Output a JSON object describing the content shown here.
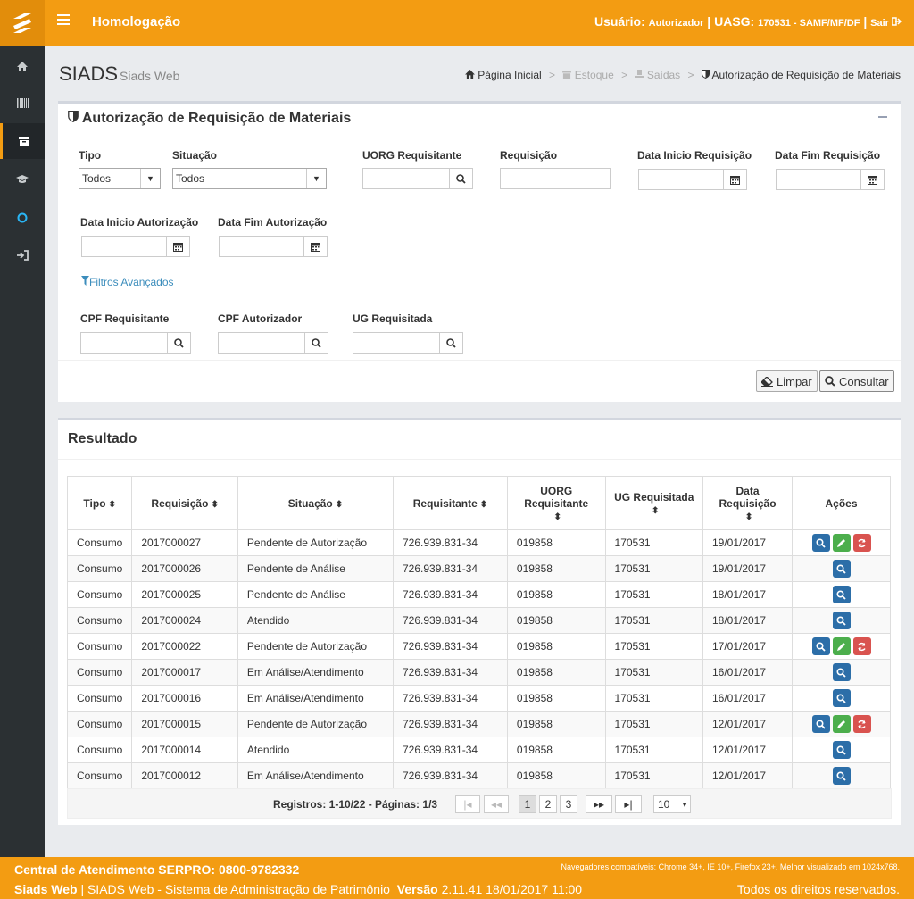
{
  "header": {
    "app_name": "Homologação",
    "user_label": "Usuário:",
    "user_value": "Autorizador",
    "uasg_label": "UASG:",
    "uasg_value": "170531 - SAMF/MF/DF",
    "logout": "Sair"
  },
  "page": {
    "title": "SIADS",
    "subtitle": "Siads Web"
  },
  "breadcrumb": [
    "Página Inicial",
    "Estoque",
    "Saídas",
    "Autorização de Requisição de Materiais"
  ],
  "filters": {
    "title": "Autorização de Requisição de Materiais",
    "tipo_label": "Tipo",
    "tipo_value": "Todos",
    "situacao_label": "Situação",
    "situacao_value": "Todos",
    "uorg_label": "UORG Requisitante",
    "requisicao_label": "Requisição",
    "data_inicio_req_label": "Data Inicio Requisição",
    "data_fim_req_label": "Data Fim Requisição",
    "data_inicio_aut_label": "Data Inicio Autorização",
    "data_fim_aut_label": "Data Fim Autorização",
    "advanced_link": "Filtros Avançados",
    "cpf_req_label": "CPF Requisitante",
    "cpf_aut_label": "CPF Autorizador",
    "ug_req_label": "UG Requisitada",
    "clear_button": "Limpar",
    "search_button": "Consultar"
  },
  "results": {
    "title": "Resultado",
    "columns": [
      "Tipo",
      "Requisição",
      "Situação",
      "Requisitante",
      "UORG Requisitante",
      "UG Requisitada",
      "Data Requisição",
      "Ações"
    ],
    "rows": [
      {
        "tipo": "Consumo",
        "requisicao": "2017000027",
        "situacao": "Pendente de Autorização",
        "requisitante": "726.939.831-34",
        "uorg": "019858",
        "ug": "170531",
        "data": "19/01/2017",
        "actions": [
          "view",
          "edit",
          "refresh"
        ]
      },
      {
        "tipo": "Consumo",
        "requisicao": "2017000026",
        "situacao": "Pendente de Análise",
        "requisitante": "726.939.831-34",
        "uorg": "019858",
        "ug": "170531",
        "data": "19/01/2017",
        "actions": [
          "view"
        ]
      },
      {
        "tipo": "Consumo",
        "requisicao": "2017000025",
        "situacao": "Pendente de Análise",
        "requisitante": "726.939.831-34",
        "uorg": "019858",
        "ug": "170531",
        "data": "18/01/2017",
        "actions": [
          "view"
        ]
      },
      {
        "tipo": "Consumo",
        "requisicao": "2017000024",
        "situacao": "Atendido",
        "requisitante": "726.939.831-34",
        "uorg": "019858",
        "ug": "170531",
        "data": "18/01/2017",
        "actions": [
          "view"
        ]
      },
      {
        "tipo": "Consumo",
        "requisicao": "2017000022",
        "situacao": "Pendente de Autorização",
        "requisitante": "726.939.831-34",
        "uorg": "019858",
        "ug": "170531",
        "data": "17/01/2017",
        "actions": [
          "view",
          "edit",
          "refresh"
        ]
      },
      {
        "tipo": "Consumo",
        "requisicao": "2017000017",
        "situacao": "Em Análise/Atendimento",
        "requisitante": "726.939.831-34",
        "uorg": "019858",
        "ug": "170531",
        "data": "16/01/2017",
        "actions": [
          "view"
        ]
      },
      {
        "tipo": "Consumo",
        "requisicao": "2017000016",
        "situacao": "Em Análise/Atendimento",
        "requisitante": "726.939.831-34",
        "uorg": "019858",
        "ug": "170531",
        "data": "16/01/2017",
        "actions": [
          "view"
        ]
      },
      {
        "tipo": "Consumo",
        "requisicao": "2017000015",
        "situacao": "Pendente de Autorização",
        "requisitante": "726.939.831-34",
        "uorg": "019858",
        "ug": "170531",
        "data": "12/01/2017",
        "actions": [
          "view",
          "edit",
          "refresh"
        ]
      },
      {
        "tipo": "Consumo",
        "requisicao": "2017000014",
        "situacao": "Atendido",
        "requisitante": "726.939.831-34",
        "uorg": "019858",
        "ug": "170531",
        "data": "12/01/2017",
        "actions": [
          "view"
        ]
      },
      {
        "tipo": "Consumo",
        "requisicao": "2017000012",
        "situacao": "Em Análise/Atendimento",
        "requisitante": "726.939.831-34",
        "uorg": "019858",
        "ug": "170531",
        "data": "12/01/2017",
        "actions": [
          "view"
        ]
      }
    ],
    "pager": {
      "text": "Registros: 1-10/22 - Páginas: 1/3",
      "first": "|◂",
      "prev": "◂◂",
      "pages": [
        "1",
        "2",
        "3"
      ],
      "next": "▸▸",
      "last": "▸|",
      "page_size": "10"
    }
  },
  "footer": {
    "central": "Central de Atendimento SERPRO: 0800-9782332",
    "browsers": "Navegadores compatíveis: Chrome 34+, IE 10+, Firefox 23+. Melhor visualizado em 1024x768.",
    "app_bold": "Siads Web",
    "app_desc": "| SIADS Web - Sistema de Administração de Patrimônio",
    "version_label": "Versão",
    "version_value": "2.11.41 18/01/2017 11:00",
    "rights": "Todos os direitos reservados."
  },
  "colors": {
    "accent": "#f39c12",
    "sidebar": "#2b3033",
    "link": "#3c8dbc"
  }
}
